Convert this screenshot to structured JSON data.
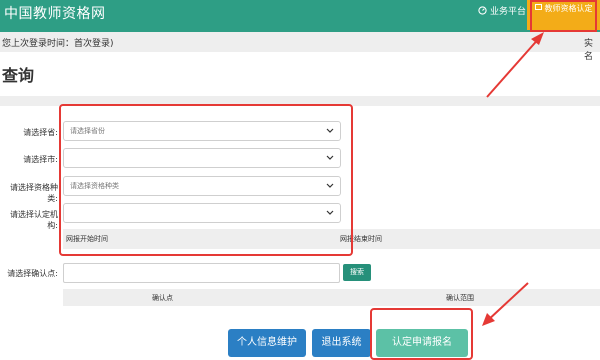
{
  "header": {
    "site_title": "中国教师资格网",
    "platform_label": "业务平台",
    "cert_label": "教师资格认定"
  },
  "subheader": {
    "last_login": "您上次登录时间：首次登录)",
    "realname_label": "实名"
  },
  "page_title": "查询",
  "form": {
    "province": {
      "label": "请选择省:",
      "placeholder": "请选择省份"
    },
    "city": {
      "label": "请选择市:",
      "value": ""
    },
    "cert_type": {
      "label": "请选择资格种类:",
      "placeholder": "请选择资格种类"
    },
    "agency": {
      "label": "请选择认定机构:",
      "value": ""
    },
    "date_start_label": "网报开始时间",
    "date_end_label": "网报结束时间",
    "confirm_point": {
      "label": "请选择确认点:",
      "value": ""
    },
    "search_label": "搜索"
  },
  "table": {
    "headers": [
      "确认点",
      "确认范围"
    ]
  },
  "buttons": {
    "profile": "个人信息维护",
    "logout": "退出系统",
    "apply": "认定申请报名"
  },
  "colors": {
    "header_green": "#2e9e85",
    "cert_orange": "#f3ac18",
    "primary_blue": "#2b7fc4",
    "apply_green": "#5cc1a6",
    "annotation_red": "#e53935"
  }
}
